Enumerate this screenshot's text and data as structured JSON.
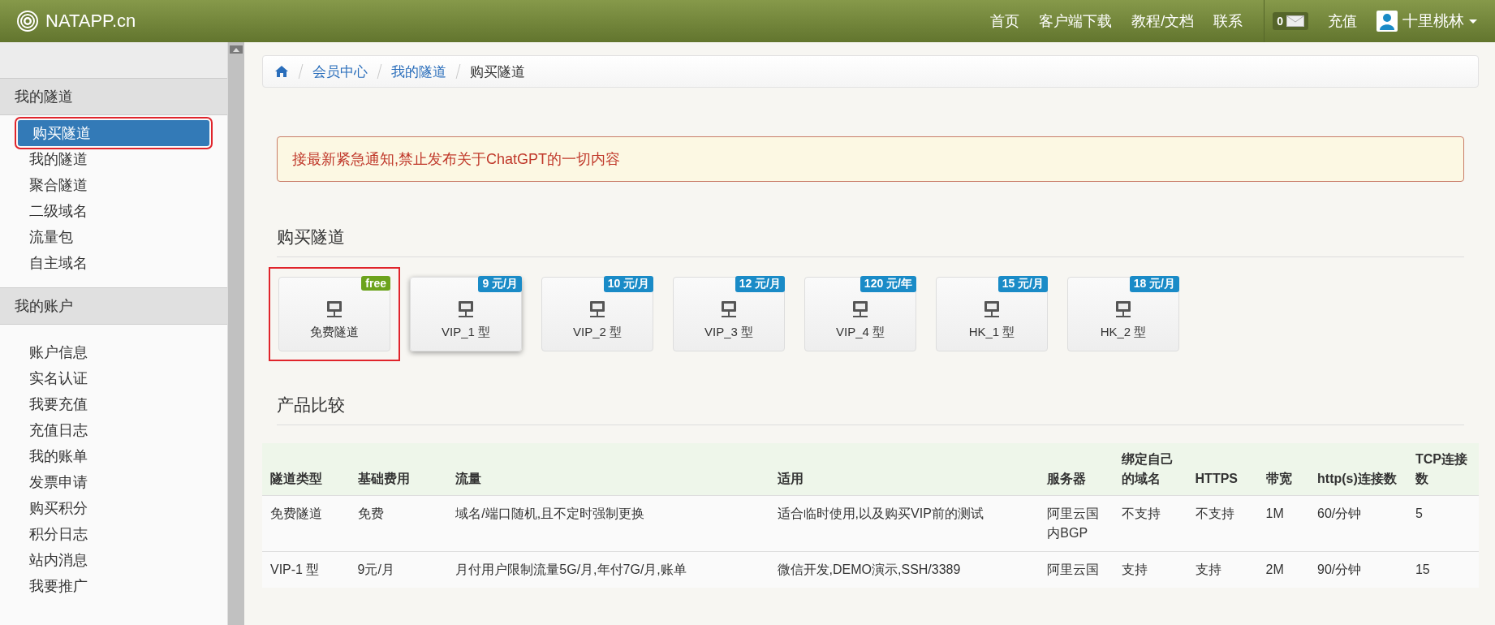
{
  "brand": {
    "name": "NATAPP.cn"
  },
  "nav": [
    {
      "label": "首页"
    },
    {
      "label": "客户端下载"
    },
    {
      "label": "教程/文档"
    },
    {
      "label": "联系"
    }
  ],
  "messages": {
    "count": "0"
  },
  "recharge": {
    "label": "充值"
  },
  "user": {
    "name": "十里桃林"
  },
  "sidebar": {
    "sections": [
      {
        "title": "我的隧道",
        "items": [
          {
            "label": "购买隧道",
            "selected": true,
            "highlighted": true
          },
          {
            "label": "我的隧道",
            "selected": false,
            "highlighted": false
          },
          {
            "label": "聚合隧道",
            "selected": false,
            "highlighted": false
          },
          {
            "label": "二级域名",
            "selected": false,
            "highlighted": false
          },
          {
            "label": "流量包",
            "selected": false,
            "highlighted": false
          },
          {
            "label": "自主域名",
            "selected": false,
            "highlighted": false
          }
        ]
      },
      {
        "title": "我的账户",
        "items": [
          {
            "label": "账户信息",
            "selected": false,
            "highlighted": false
          },
          {
            "label": "实名认证",
            "selected": false,
            "highlighted": false
          },
          {
            "label": "我要充值",
            "selected": false,
            "highlighted": false
          },
          {
            "label": "充值日志",
            "selected": false,
            "highlighted": false
          },
          {
            "label": "我的账单",
            "selected": false,
            "highlighted": false
          },
          {
            "label": "发票申请",
            "selected": false,
            "highlighted": false
          },
          {
            "label": "购买积分",
            "selected": false,
            "highlighted": false
          },
          {
            "label": "积分日志",
            "selected": false,
            "highlighted": false
          },
          {
            "label": "站内消息",
            "selected": false,
            "highlighted": false
          },
          {
            "label": "我要推广",
            "selected": false,
            "highlighted": false
          }
        ]
      }
    ]
  },
  "breadcrumb": [
    {
      "label": "会员中心",
      "current": false
    },
    {
      "label": "我的隧道",
      "current": false
    },
    {
      "label": "购买隧道",
      "current": true
    }
  ],
  "alert": {
    "text": "接最新紧急通知,禁止发布关于ChatGPT的一切内容"
  },
  "purchase": {
    "title": "购买隧道",
    "plans": [
      {
        "name": "免费隧道",
        "price": "free",
        "color": "#6ca31c",
        "selected": false,
        "highlighted": true
      },
      {
        "name": "VIP_1 型",
        "price": "9 元/月",
        "color": "#1a8bc7",
        "selected": true,
        "highlighted": false
      },
      {
        "name": "VIP_2 型",
        "price": "10 元/月",
        "color": "#1a8bc7",
        "selected": false,
        "highlighted": false
      },
      {
        "name": "VIP_3 型",
        "price": "12 元/月",
        "color": "#1a8bc7",
        "selected": false,
        "highlighted": false
      },
      {
        "name": "VIP_4 型",
        "price": "120 元/年",
        "color": "#1a8bc7",
        "selected": false,
        "highlighted": false
      },
      {
        "name": "HK_1 型",
        "price": "15 元/月",
        "color": "#1a8bc7",
        "selected": false,
        "highlighted": false
      },
      {
        "name": "HK_2 型",
        "price": "18 元/月",
        "color": "#1a8bc7",
        "selected": false,
        "highlighted": false
      }
    ]
  },
  "compare": {
    "title": "产品比较",
    "columns": [
      "隧道类型",
      "基础费用",
      "流量",
      "适用",
      "服务器",
      "绑定自己的域名",
      "HTTPS",
      "带宽",
      "http(s)连接数",
      "TCP连接数"
    ],
    "rows": [
      [
        "免费隧道",
        "免费",
        "域名/端口随机,且不定时强制更换",
        "适合临时使用,以及购买VIP前的测试",
        "阿里云国内BGP",
        "不支持",
        "不支持",
        "1M",
        "60/分钟",
        "5"
      ],
      [
        "VIP-1 型",
        "9元/月",
        "月付用户限制流量5G/月,年付7G/月,账单",
        "微信开发,DEMO演示,SSH/3389",
        "阿里云国",
        "支持",
        "支持",
        "2M",
        "90/分钟",
        "15"
      ]
    ]
  }
}
